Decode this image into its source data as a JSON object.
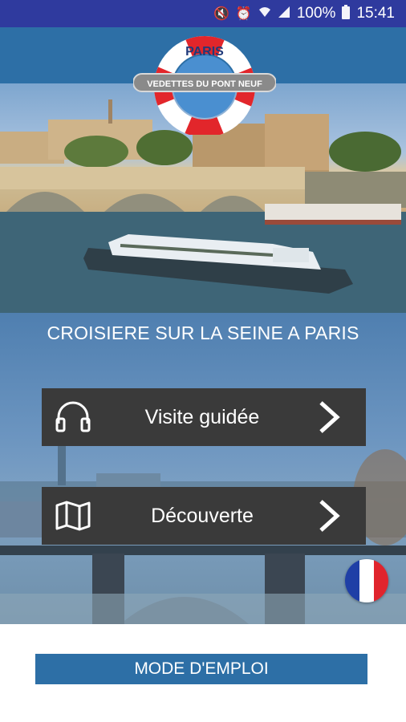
{
  "status_bar": {
    "battery": "100%",
    "time": "15:41",
    "icons": [
      "mute-icon",
      "alarm-icon",
      "wifi-icon",
      "signal-icon",
      "battery-icon"
    ]
  },
  "logo": {
    "top_text": "PARIS",
    "band_text": "VEDETTES DU PONT NEUF"
  },
  "subtitle": "CROISIERE SUR LA SEINE A PARIS",
  "menu": [
    {
      "label": "Visite guidée",
      "icon": "headphones-icon"
    },
    {
      "label": "Découverte",
      "icon": "map-icon"
    }
  ],
  "language_flag": "france-flag",
  "footer_button": "MODE D'EMPLOI",
  "colors": {
    "status_bar": "#2f3a9e",
    "header": "#2d6fa6",
    "button_dark": "#3a3a3a",
    "footer_button": "#2d6fa6",
    "flag_blue": "#1f3fa6",
    "flag_white": "#ffffff",
    "flag_red": "#e0242d"
  }
}
